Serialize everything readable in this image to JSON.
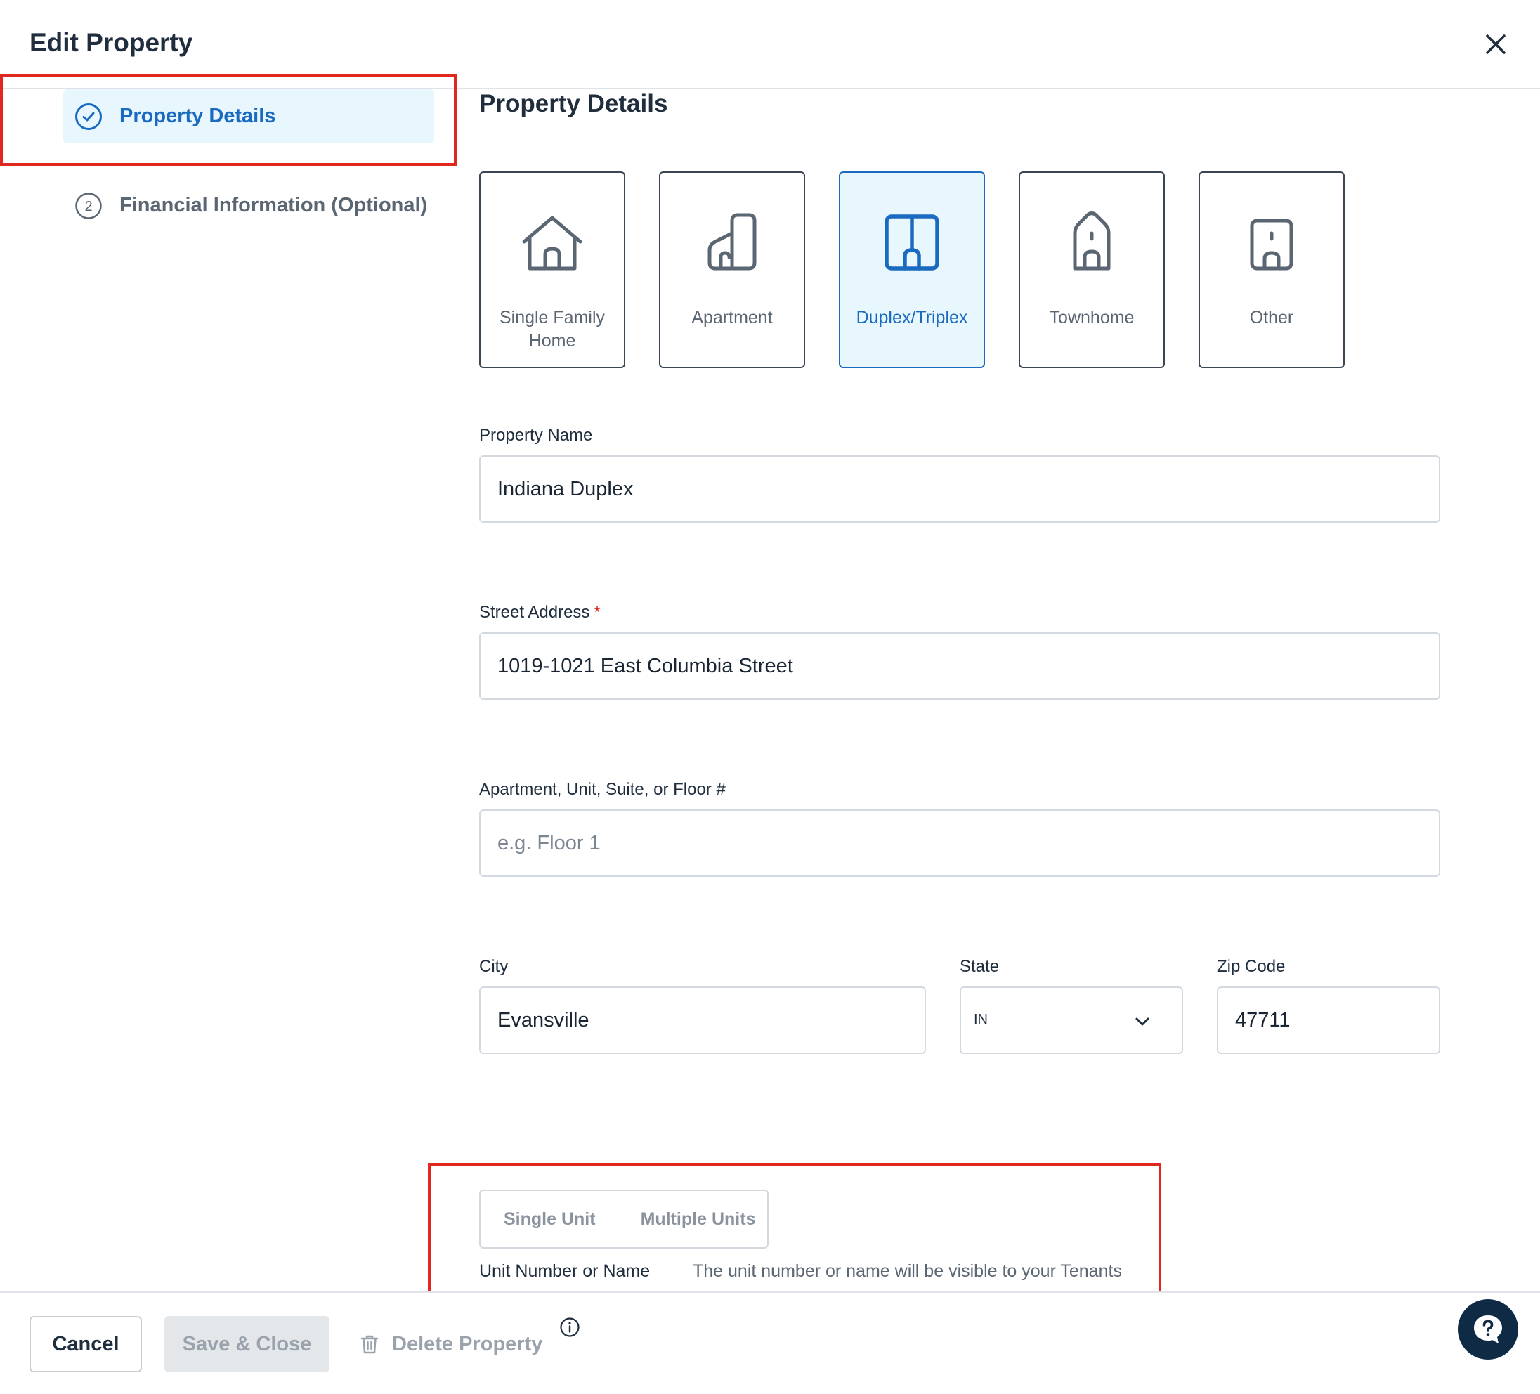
{
  "modal": {
    "title": "Edit Property"
  },
  "steps": [
    {
      "number": "",
      "label": "Property Details",
      "state": "active"
    },
    {
      "number": "2",
      "label": "Financial Information (Optional)",
      "state": "inactive"
    }
  ],
  "section": {
    "title": "Property Details"
  },
  "property_types": [
    {
      "label": "Single Family Home",
      "icon": "house-icon",
      "selected": false
    },
    {
      "label": "Apartment",
      "icon": "apartment-building-icon",
      "selected": false
    },
    {
      "label": "Duplex/Triplex",
      "icon": "duplex-icon",
      "selected": true
    },
    {
      "label": "Townhome",
      "icon": "townhome-icon",
      "selected": false
    },
    {
      "label": "Other",
      "icon": "other-building-icon",
      "selected": false
    }
  ],
  "form": {
    "property_name": {
      "label": "Property Name",
      "value": "Indiana Duplex"
    },
    "street_address": {
      "label": "Street Address",
      "required_mark": "*",
      "value": "1019-1021 East Columbia Street"
    },
    "unit": {
      "label": "Apartment, Unit, Suite, or Floor #",
      "value": "",
      "placeholder": "e.g. Floor 1"
    },
    "city": {
      "label": "City",
      "value": "Evansville"
    },
    "state": {
      "label": "State",
      "value": "IN"
    },
    "zip": {
      "label": "Zip Code",
      "value": "47711"
    }
  },
  "units": {
    "options": [
      "Single Unit",
      "Multiple Units"
    ],
    "name_label": "Unit Number or Name",
    "helper": "The unit number or name will be visible to your Tenants"
  },
  "footer": {
    "cancel": "Cancel",
    "save": "Save & Close",
    "delete": "Delete Property"
  },
  "colors": {
    "accent": "#1a6bc0",
    "selected_bg": "#e8f6fd",
    "annotation": "#e0281f",
    "help_button": "#0f2a44"
  }
}
